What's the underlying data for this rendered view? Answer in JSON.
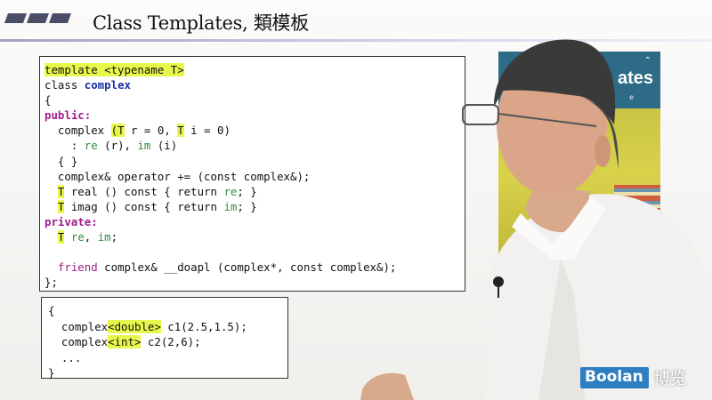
{
  "slide": {
    "title": "Class Templates, 類模板"
  },
  "code_main": {
    "lines": [
      [
        {
          "t": "template <typename T>",
          "c": "hl"
        }
      ],
      [
        {
          "t": "class "
        },
        {
          "t": "complex",
          "c": "kw-blue"
        }
      ],
      [
        {
          "t": "{"
        }
      ],
      [
        {
          "t": "public:",
          "c": "kw-purple"
        }
      ],
      [
        {
          "t": "  complex "
        },
        {
          "t": "(T",
          "c": "hl"
        },
        {
          "t": " r = 0, "
        },
        {
          "t": "T",
          "c": "hl"
        },
        {
          "t": " i = 0)"
        }
      ],
      [
        {
          "t": "    : "
        },
        {
          "t": "re",
          "c": "kw-green"
        },
        {
          "t": " (r), "
        },
        {
          "t": "im",
          "c": "kw-green"
        },
        {
          "t": " (i)"
        }
      ],
      [
        {
          "t": "  { }"
        }
      ],
      [
        {
          "t": "  complex& operator += (const complex&);"
        }
      ],
      [
        {
          "t": "  "
        },
        {
          "t": "T",
          "c": "hl"
        },
        {
          "t": " real () const { return "
        },
        {
          "t": "re",
          "c": "kw-green"
        },
        {
          "t": "; }"
        }
      ],
      [
        {
          "t": "  "
        },
        {
          "t": "T",
          "c": "hl"
        },
        {
          "t": " imag () const { return "
        },
        {
          "t": "im",
          "c": "kw-green"
        },
        {
          "t": "; }"
        }
      ],
      [
        {
          "t": "private:",
          "c": "kw-purple"
        }
      ],
      [
        {
          "t": "  "
        },
        {
          "t": "T",
          "c": "hl"
        },
        {
          "t": " "
        },
        {
          "t": "re",
          "c": "kw-green"
        },
        {
          "t": ", "
        },
        {
          "t": "im",
          "c": "kw-green"
        },
        {
          "t": ";"
        }
      ],
      [
        {
          "t": ""
        }
      ],
      [
        {
          "t": "  "
        },
        {
          "t": "friend",
          "c": "kw-friend"
        },
        {
          "t": " complex& __doapl (complex*, const complex&);"
        }
      ],
      [
        {
          "t": "};"
        }
      ]
    ]
  },
  "code_usage": {
    "lines": [
      [
        {
          "t": "{"
        }
      ],
      [
        {
          "t": "  complex"
        },
        {
          "t": "<double>",
          "c": "hl"
        },
        {
          "t": " c1(2.5,1.5);"
        }
      ],
      [
        {
          "t": "  complex"
        },
        {
          "t": "<int>",
          "c": "hl"
        },
        {
          "t": " c2(2,6);"
        }
      ],
      [
        {
          "t": "  ..."
        }
      ],
      [
        {
          "t": "}"
        }
      ]
    ]
  },
  "book": {
    "title_fragment": "ates",
    "subtitle_fragment": "e"
  },
  "logo": {
    "en": "Boolan",
    "cn": "博览"
  },
  "colors": {
    "highlight": "#e8f84a",
    "keyword_blue": "#1b2ea8",
    "keyword_purple": "#a01c8c",
    "member_green": "#2f8f3c",
    "logo_blue": "#2e7fc2"
  }
}
